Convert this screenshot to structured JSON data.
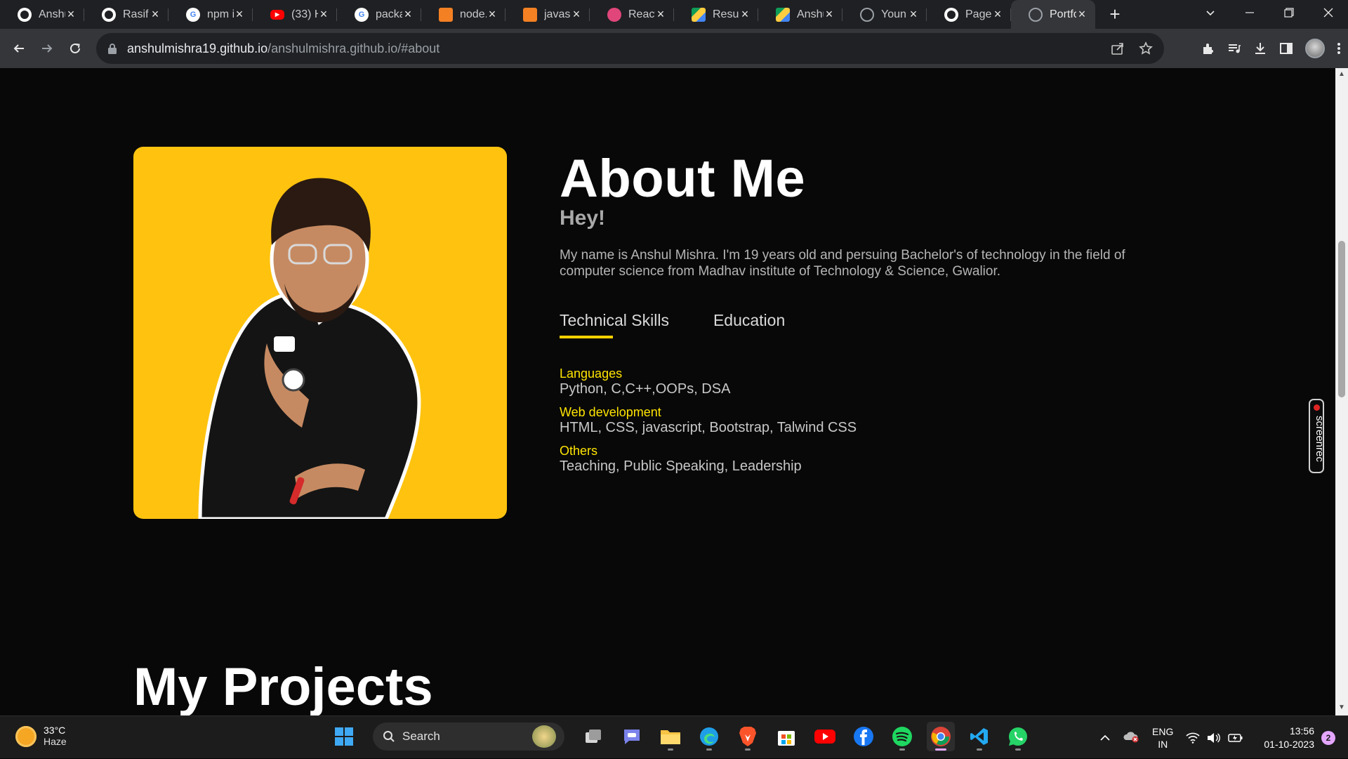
{
  "browser": {
    "tabs": [
      {
        "title": "Anshu",
        "icon": "github-icon",
        "color": "#ffffff"
      },
      {
        "title": "Rasif",
        "icon": "github-icon",
        "color": "#ffffff"
      },
      {
        "title": "npm i",
        "icon": "google-icon",
        "color": "#4285f4"
      },
      {
        "title": "(33) H",
        "icon": "youtube-icon",
        "color": "#ff0000"
      },
      {
        "title": "packa",
        "icon": "google-icon",
        "color": "#4285f4"
      },
      {
        "title": "node.",
        "icon": "stackoverflow-icon",
        "color": "#f48024"
      },
      {
        "title": "javas",
        "icon": "stackoverflow-icon",
        "color": "#f48024"
      },
      {
        "title": "React",
        "icon": "react-icon",
        "color": "#e0467a"
      },
      {
        "title": "Resun",
        "icon": "drive-icon",
        "color": "#1fa463"
      },
      {
        "title": "Anshu",
        "icon": "drive-icon",
        "color": "#1fa463"
      },
      {
        "title": "Youn",
        "icon": "globe-icon",
        "color": "#9aa0a6"
      },
      {
        "title": "Page:",
        "icon": "github-icon",
        "color": "#ffffff"
      },
      {
        "title": "Portfo",
        "icon": "globe-icon",
        "color": "#9aa0a6",
        "active": true
      }
    ],
    "url_host": "anshulmishra19.github.io",
    "url_path": "/anshulmishra.github.io/#about"
  },
  "about": {
    "title": "About Me",
    "greeting": "Hey!",
    "bio": "My name is Anshul Mishra. I'm 19 years old and persuing Bachelor's of technology in the field of computer science from Madhav institute of Technology & Science, Gwalior.",
    "tabs": [
      "Technical Skills",
      "Education"
    ],
    "skills": [
      {
        "title": "Languages",
        "value": "Python, C,C++,OOPs, DSA"
      },
      {
        "title": "Web development",
        "value": "HTML, CSS, javascript, Bootstrap, Talwind CSS"
      },
      {
        "title": "Others",
        "value": "Teaching, Public Speaking, Leadership"
      }
    ],
    "accent_color": "#ffc30f"
  },
  "projects": {
    "title": "My Projects"
  },
  "screenrec": {
    "label": "screenrec"
  },
  "taskbar": {
    "weather_temp": "33°C",
    "weather_desc": "Haze",
    "search_label": "Search",
    "lang_top": "ENG",
    "lang_bottom": "IN",
    "time": "13:56",
    "date": "01-10-2023",
    "notification_count": "2"
  }
}
